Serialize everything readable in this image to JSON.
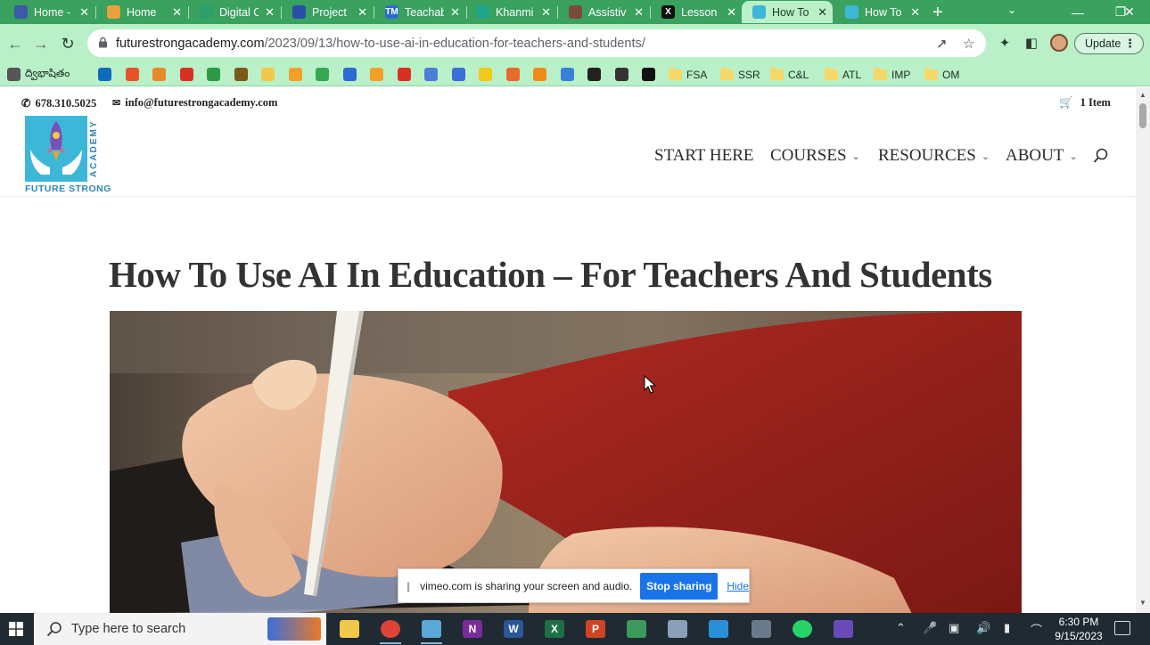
{
  "browser": {
    "tabs": [
      {
        "title": "Home -",
        "color": "#3b5aa8",
        "glyph": ""
      },
      {
        "title": "Home",
        "color": "#e8a23a",
        "glyph": ""
      },
      {
        "title": "Digital C",
        "color": "#2aa06a",
        "glyph": ""
      },
      {
        "title": "Project",
        "color": "#2a4fa8",
        "glyph": ""
      },
      {
        "title": "Teachab",
        "color": "#2b6cd4",
        "glyph": "TM"
      },
      {
        "title": "Khanmi",
        "color": "#1fa58a",
        "glyph": ""
      },
      {
        "title": "Assistiv",
        "color": "#7a4b3b",
        "glyph": ""
      },
      {
        "title": "Lesson",
        "color": "#111111",
        "glyph": "X"
      },
      {
        "title": "How To",
        "color": "#3db7d8",
        "glyph": ""
      },
      {
        "title": "How To",
        "color": "#3db7d8",
        "glyph": ""
      }
    ],
    "url_host": "futurestrongacademy.com",
    "url_path": "/2023/09/13/how-to-use-ai-in-education-for-teachers-and-students/",
    "update_label": "Update",
    "bookmarks": [
      {
        "label": "ద్విభాషితం",
        "color": "#555555"
      },
      {
        "label": "",
        "color": "#0f6cbd"
      },
      {
        "label": "",
        "color": "#e8542a"
      },
      {
        "label": "",
        "color": "#e88a2a"
      },
      {
        "label": "",
        "color": "#d93025"
      },
      {
        "label": "",
        "color": "#2d9a4a"
      },
      {
        "label": "",
        "color": "#7a5a1a"
      },
      {
        "label": "",
        "color": "#f2c84b"
      },
      {
        "label": "",
        "color": "#f2a02a"
      },
      {
        "label": "",
        "color": "#36a852"
      },
      {
        "label": "",
        "color": "#2b6cd4"
      },
      {
        "label": "",
        "color": "#f2a02a"
      },
      {
        "label": "",
        "color": "#d93025"
      },
      {
        "label": "",
        "color": "#4a7fd8"
      },
      {
        "label": "",
        "color": "#3a6fd8"
      },
      {
        "label": "",
        "color": "#f2c81a"
      },
      {
        "label": "",
        "color": "#e86a2a"
      },
      {
        "label": "",
        "color": "#f28a1a"
      },
      {
        "label": "",
        "color": "#3a7fd8"
      },
      {
        "label": "",
        "color": "#222222"
      },
      {
        "label": "",
        "color": "#333333"
      },
      {
        "label": "",
        "color": "#111111"
      }
    ],
    "folders": [
      "FSA",
      "SSR",
      "C&L",
      "ATL",
      "IMP",
      "OM"
    ]
  },
  "site": {
    "phone": "678.310.5025",
    "email": "info@futurestrongacademy.com",
    "cart": "1 Item",
    "logo_vertical": "ACADEMY",
    "logo_word": "FUTURE STRONG",
    "nav": [
      {
        "label": "START HERE",
        "chevron": false
      },
      {
        "label": "COURSES",
        "chevron": true
      },
      {
        "label": "RESOURCES",
        "chevron": true
      },
      {
        "label": "ABOUT",
        "chevron": true
      }
    ],
    "title": "How To Use AI In Education – For Teachers And Students"
  },
  "sharing": {
    "message": "vimeo.com is sharing your screen and audio.",
    "stop_label": "Stop sharing",
    "hide_label": "Hide"
  },
  "taskbar": {
    "search_placeholder": "Type here to search",
    "time": "6:30 PM",
    "date": "9/15/2023",
    "apps": [
      {
        "name": "file-explorer",
        "color": "#f2c84b",
        "glyph": ""
      },
      {
        "name": "chrome",
        "color": "#db4437",
        "glyph": ""
      },
      {
        "name": "app-blue",
        "color": "#5aa7d8",
        "glyph": ""
      },
      {
        "name": "onenote",
        "color": "#7a2c9a",
        "glyph": "N"
      },
      {
        "name": "word",
        "color": "#2b5797",
        "glyph": "W"
      },
      {
        "name": "excel",
        "color": "#1e7145",
        "glyph": "X"
      },
      {
        "name": "powerpoint",
        "color": "#d04423",
        "glyph": "P"
      },
      {
        "name": "app-green",
        "color": "#3a9a5a",
        "glyph": ""
      },
      {
        "name": "app-grey",
        "color": "#8aa0b8",
        "glyph": ""
      },
      {
        "name": "app-cyan",
        "color": "#2b8fd8",
        "glyph": ""
      },
      {
        "name": "camera",
        "color": "#6a7a8a",
        "glyph": ""
      },
      {
        "name": "whatsapp",
        "color": "#25d366",
        "glyph": ""
      },
      {
        "name": "app-purple",
        "color": "#6a4ab8",
        "glyph": ""
      }
    ]
  }
}
